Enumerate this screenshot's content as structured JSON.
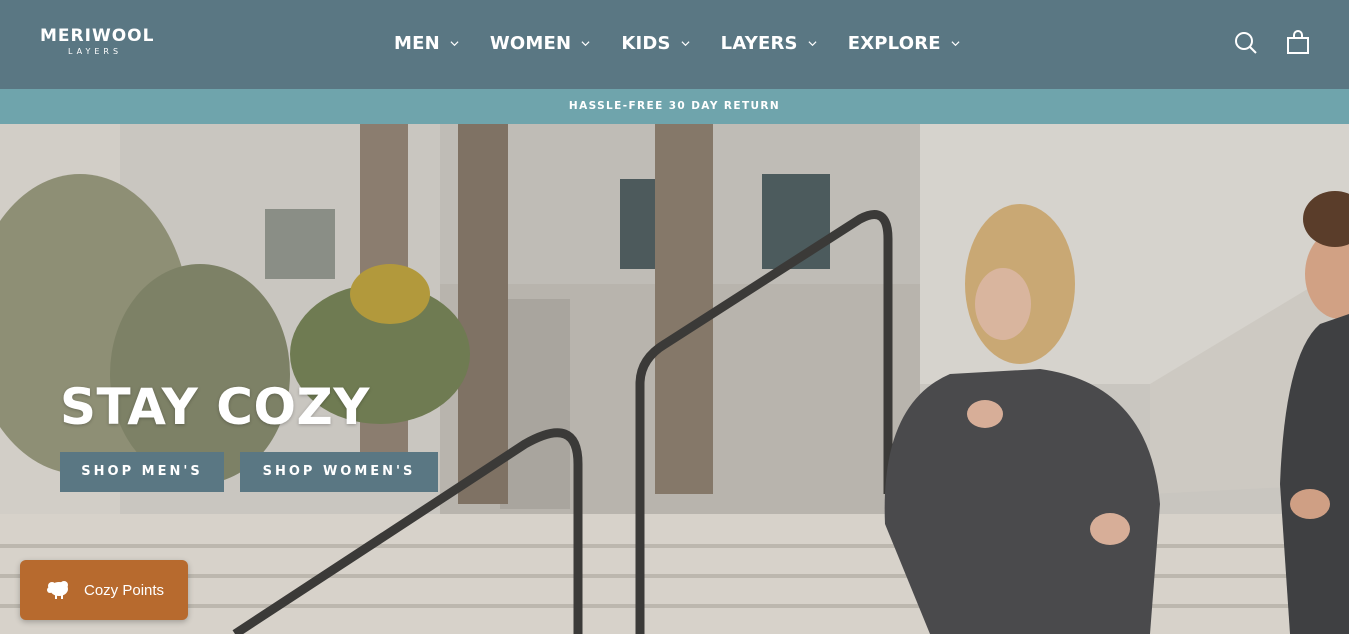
{
  "header": {
    "logo_main": "MERIWOOL",
    "logo_sub": "LAYERS",
    "nav": [
      {
        "label": "MEN"
      },
      {
        "label": "WOMEN"
      },
      {
        "label": "KIDS"
      },
      {
        "label": "LAYERS"
      },
      {
        "label": "EXPLORE"
      }
    ],
    "icons": [
      "search-icon",
      "cart-icon"
    ]
  },
  "announcement": {
    "text": "HASSLE-FREE 30 DAY RETURN"
  },
  "hero": {
    "title": "STAY COZY",
    "buttons": [
      {
        "label": "SHOP MEN'S"
      },
      {
        "label": "SHOP WOMEN'S"
      }
    ]
  },
  "rewards": {
    "label": "Cozy Points",
    "icon": "sheep-icon"
  },
  "colors": {
    "header_bg": "#5a7783",
    "announcement_bg": "#6fa4ac",
    "button_bg": "#5a7783",
    "rewards_bg": "#b76a2e"
  }
}
